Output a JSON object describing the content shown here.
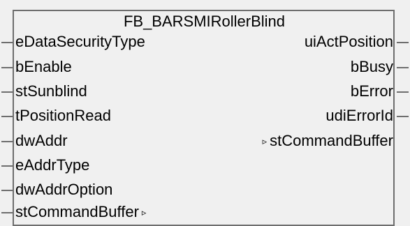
{
  "block": {
    "title": "FB_BARSMIRollerBlind",
    "inputs": [
      {
        "label": "eDataSecurityType"
      },
      {
        "label": "bEnable"
      },
      {
        "label": "stSunblind"
      },
      {
        "label": "tPositionRead"
      },
      {
        "label": "dwAddr"
      },
      {
        "label": "eAddrType"
      },
      {
        "label": "dwAddrOption"
      },
      {
        "label": "stCommandBuffer",
        "reference_marker": "▹"
      }
    ],
    "outputs": [
      {
        "label": "uiActPosition"
      },
      {
        "label": "bBusy"
      },
      {
        "label": "bError"
      },
      {
        "label": "udiErrorId"
      },
      {
        "label": "stCommandBuffer",
        "reference_marker": "▹"
      }
    ]
  }
}
